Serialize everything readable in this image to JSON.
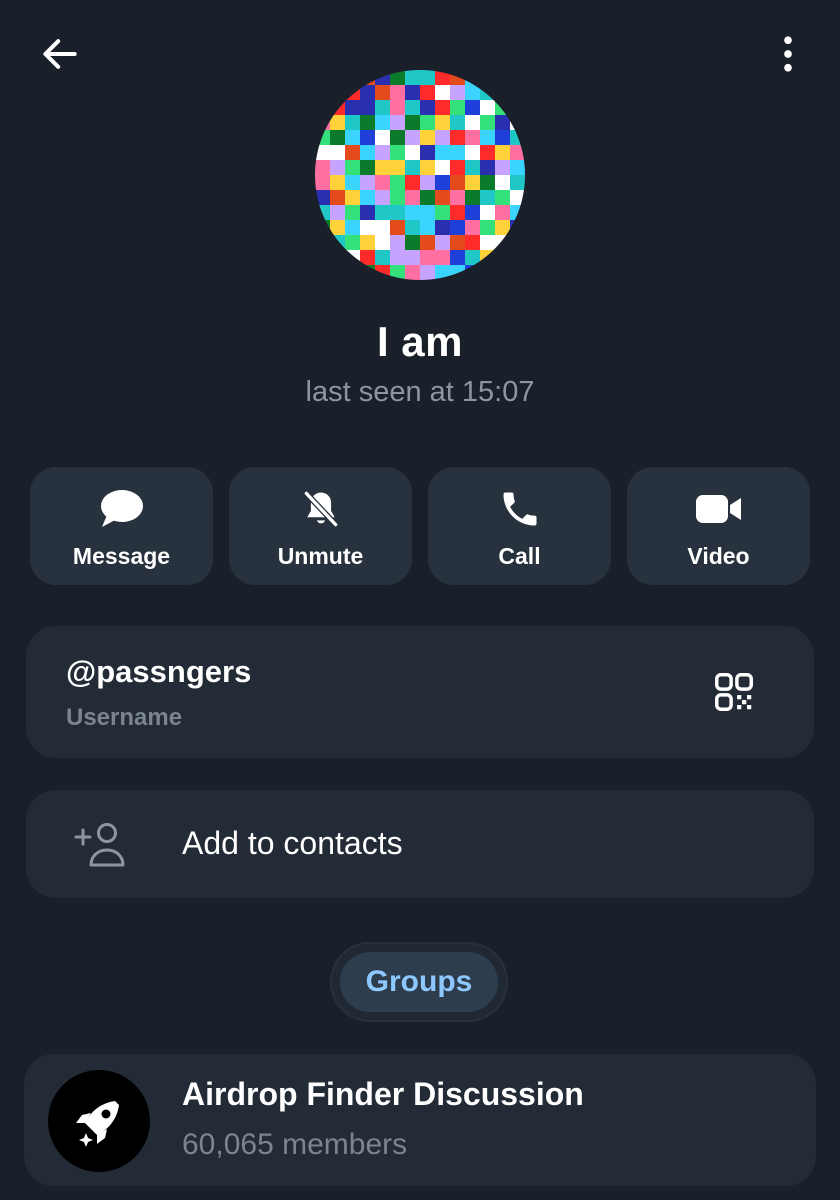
{
  "topbar": {
    "back_icon": "arrow-left-icon",
    "menu_icon": "more-vertical-icon"
  },
  "profile": {
    "name": "I am",
    "status": "last seen at 15:07",
    "avatar_icon": "pixelated-avatar"
  },
  "actions": [
    {
      "label": "Message",
      "icon": "chat-bubble-icon"
    },
    {
      "label": "Unmute",
      "icon": "bell-off-icon"
    },
    {
      "label": "Call",
      "icon": "phone-icon"
    },
    {
      "label": "Video",
      "icon": "video-camera-icon"
    }
  ],
  "username": {
    "value": "@passngers",
    "label": "Username",
    "qr_icon": "qr-code-icon"
  },
  "contacts": {
    "label": "Add to contacts",
    "icon": "add-person-icon"
  },
  "groups_tab": {
    "label": "Groups"
  },
  "groups": [
    {
      "name": "Airdrop Finder Discussion",
      "members": "60,065 members",
      "icon": "rocket-icon"
    }
  ],
  "colors": {
    "background": "#1a2029",
    "card": "#222b36",
    "button": "#28323e",
    "accent": "#8fc7ff",
    "muted_text": "#7b8592"
  }
}
